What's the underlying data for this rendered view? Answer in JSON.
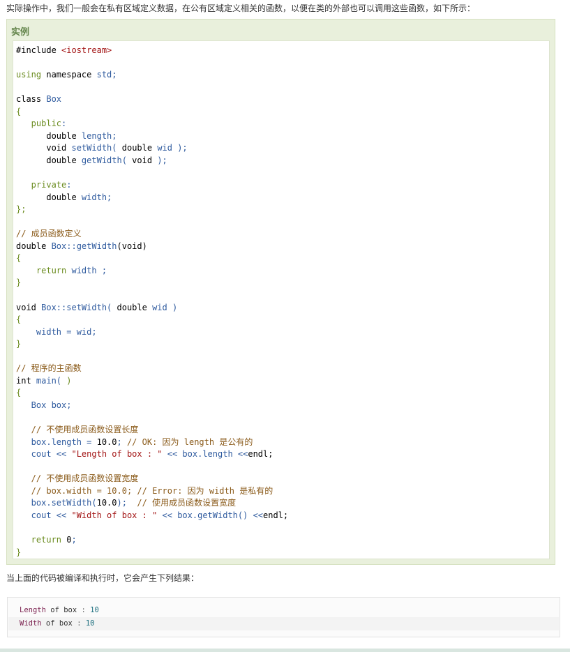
{
  "intro_text": "实际操作中，我们一般会在私有区域定义数据，在公有区域定义相关的函数，以便在类的外部也可以调用这些函数，如下所示：",
  "example": {
    "title": "实例",
    "code_lines": [
      [
        {
          "t": "#include ",
          "c": "#000000"
        },
        {
          "t": "<iostream>",
          "c": "#a31515"
        }
      ],
      [],
      [
        {
          "t": "using",
          "c": "#6a8b1e"
        },
        {
          "t": " namespace ",
          "c": "#000000"
        },
        {
          "t": "std;",
          "c": "#2e5a9e"
        }
      ],
      [],
      [
        {
          "t": "class ",
          "c": "#000000"
        },
        {
          "t": "Box",
          "c": "#2e5a9e"
        }
      ],
      [
        {
          "t": "{",
          "c": "#6a8b1e"
        }
      ],
      [
        {
          "t": "   public",
          "c": "#6a8b1e"
        },
        {
          "t": ":",
          "c": "#2e5a9e"
        }
      ],
      [
        {
          "t": "      double ",
          "c": "#000000"
        },
        {
          "t": "length;",
          "c": "#2e5a9e"
        }
      ],
      [
        {
          "t": "      void ",
          "c": "#000000"
        },
        {
          "t": "setWidth(",
          "c": "#2e5a9e"
        },
        {
          "t": " double ",
          "c": "#000000"
        },
        {
          "t": "wid );",
          "c": "#2e5a9e"
        }
      ],
      [
        {
          "t": "      double ",
          "c": "#000000"
        },
        {
          "t": "getWidth(",
          "c": "#2e5a9e"
        },
        {
          "t": " void ",
          "c": "#000000"
        },
        {
          "t": ");",
          "c": "#2e5a9e"
        }
      ],
      [],
      [
        {
          "t": "   private",
          "c": "#6a8b1e"
        },
        {
          "t": ":",
          "c": "#2e5a9e"
        }
      ],
      [
        {
          "t": "      double ",
          "c": "#000000"
        },
        {
          "t": "width;",
          "c": "#2e5a9e"
        }
      ],
      [
        {
          "t": "};",
          "c": "#6a8b1e"
        }
      ],
      [],
      [
        {
          "t": "// 成员函数定义",
          "c": "#8a5a19"
        }
      ],
      [
        {
          "t": "double ",
          "c": "#000000"
        },
        {
          "t": "Box::getWidth",
          "c": "#2e5a9e"
        },
        {
          "t": "(void)",
          "c": "#000000"
        }
      ],
      [
        {
          "t": "{",
          "c": "#6a8b1e"
        }
      ],
      [
        {
          "t": "    return",
          "c": "#6a8b1e"
        },
        {
          "t": " width ;",
          "c": "#2e5a9e"
        }
      ],
      [
        {
          "t": "}",
          "c": "#6a8b1e"
        }
      ],
      [],
      [
        {
          "t": "void ",
          "c": "#000000"
        },
        {
          "t": "Box::setWidth(",
          "c": "#2e5a9e"
        },
        {
          "t": " double ",
          "c": "#000000"
        },
        {
          "t": "wid )",
          "c": "#2e5a9e"
        }
      ],
      [
        {
          "t": "{",
          "c": "#6a8b1e"
        }
      ],
      [
        {
          "t": "    width = wid;",
          "c": "#2e5a9e"
        }
      ],
      [
        {
          "t": "}",
          "c": "#6a8b1e"
        }
      ],
      [],
      [
        {
          "t": "// 程序的主函数",
          "c": "#8a5a19"
        }
      ],
      [
        {
          "t": "int ",
          "c": "#000000"
        },
        {
          "t": "main(",
          "c": "#2e5a9e"
        },
        {
          "t": " )",
          "c": "#6a8b1e"
        }
      ],
      [
        {
          "t": "{",
          "c": "#6a8b1e"
        }
      ],
      [
        {
          "t": "   Box box;",
          "c": "#2e5a9e"
        }
      ],
      [],
      [
        {
          "t": "   // 不使用成员函数设置长度",
          "c": "#8a5a19"
        }
      ],
      [
        {
          "t": "   box.length = ",
          "c": "#2e5a9e"
        },
        {
          "t": "10.0",
          "c": "#000000"
        },
        {
          "t": "; ",
          "c": "#2e5a9e"
        },
        {
          "t": "// OK: 因为 length 是公有的",
          "c": "#8a5a19"
        }
      ],
      [
        {
          "t": "   cout << ",
          "c": "#2e5a9e"
        },
        {
          "t": "\"Length of box : \"",
          "c": "#a31515"
        },
        {
          "t": " << box.length <<",
          "c": "#2e5a9e"
        },
        {
          "t": "endl;",
          "c": "#000000"
        }
      ],
      [],
      [
        {
          "t": "   // 不使用成员函数设置宽度",
          "c": "#8a5a19"
        }
      ],
      [
        {
          "t": "   // box.width = 10.0; // Error: 因为 width 是私有的",
          "c": "#8a5a19"
        }
      ],
      [
        {
          "t": "   box.setWidth(",
          "c": "#2e5a9e"
        },
        {
          "t": "10.0",
          "c": "#000000"
        },
        {
          "t": ");  ",
          "c": "#2e5a9e"
        },
        {
          "t": "// 使用成员函数设置宽度",
          "c": "#8a5a19"
        }
      ],
      [
        {
          "t": "   cout << ",
          "c": "#2e5a9e"
        },
        {
          "t": "\"Width of box : \"",
          "c": "#a31515"
        },
        {
          "t": " << box.getWidth() <<",
          "c": "#2e5a9e"
        },
        {
          "t": "endl;",
          "c": "#000000"
        }
      ],
      [],
      [
        {
          "t": "   return ",
          "c": "#6a8b1e"
        },
        {
          "t": "0",
          "c": "#000000"
        },
        {
          "t": ";",
          "c": "#2e5a9e"
        }
      ],
      [
        {
          "t": "}",
          "c": "#6a8b1e"
        }
      ]
    ]
  },
  "result_intro": "当上面的代码被编译和执行时，它会产生下列结果：",
  "output_lines": [
    [
      {
        "t": "Length",
        "c": "#7a1f4e"
      },
      {
        "t": " of box ",
        "c": "#333333"
      },
      {
        "t": ":",
        "c": "#666666"
      },
      {
        "t": " 10",
        "c": "#1b6e7e"
      }
    ],
    [
      {
        "t": "Width",
        "c": "#7a1f4e"
      },
      {
        "t": " of box ",
        "c": "#333333"
      },
      {
        "t": ":",
        "c": "#666666"
      },
      {
        "t": " 10",
        "c": "#1b6e7e"
      }
    ]
  ]
}
